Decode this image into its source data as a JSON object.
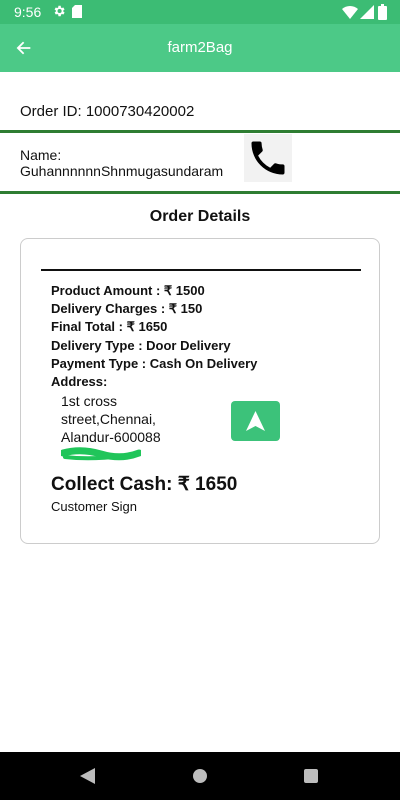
{
  "status_bar": {
    "time": "9:56"
  },
  "app_bar": {
    "title": "farm2Bag"
  },
  "order": {
    "id_label": "Order ID: 1000730420002",
    "name_label": "Name:",
    "name_value": "GuhannnnnnShnmugasundaram"
  },
  "section_title": "Order Details",
  "details": {
    "product_amount": "Product Amount : ₹ 1500",
    "delivery_charges": "Delivery Charges : ₹ 150",
    "final_total": "Final Total : ₹ 1650",
    "delivery_type": "Delivery Type : Door Delivery",
    "payment_type": "Payment Type : Cash On Delivery",
    "address_label": "Address:",
    "address_lines": [
      "1st cross",
      "street,Chennai,",
      "Alandur-600088"
    ],
    "collect_cash": "Collect Cash: ₹ 1650",
    "customer_sign": "Customer Sign"
  },
  "colors": {
    "status_bar": "#3cbc74",
    "app_bar": "#4cc987",
    "divider": "#2e7d32",
    "nav_button": "#3cc27a"
  },
  "icons": {
    "back": "arrow-left-icon",
    "phone": "phone-icon",
    "navigate": "navigation-arrow-icon"
  }
}
